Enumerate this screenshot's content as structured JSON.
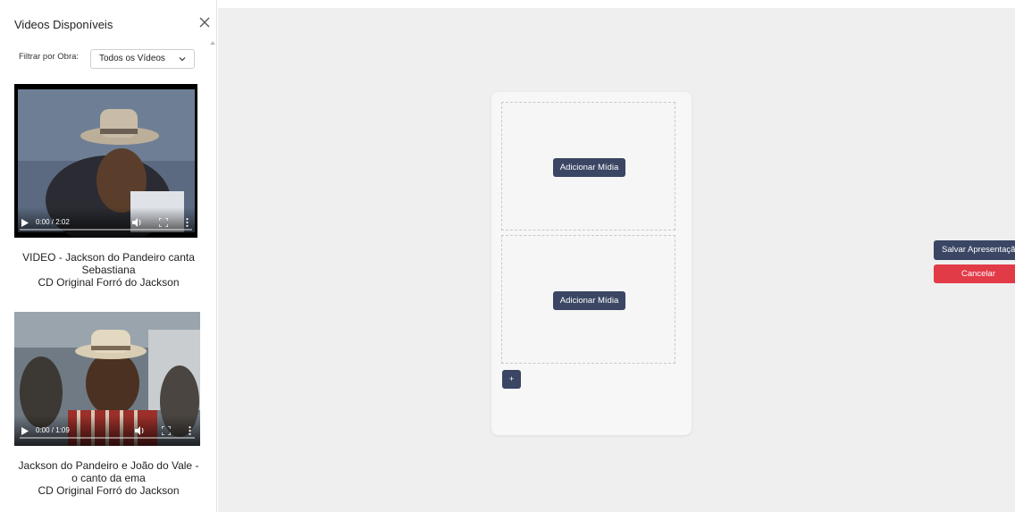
{
  "sidebar": {
    "title": "Videos Disponíveis",
    "filter": {
      "label": "Filtrar por Obra:",
      "selected": "Todos os Vídeos"
    },
    "videos": [
      {
        "time": "0:00 / 2:02",
        "caption_lines": [
          "VIDEO - Jackson do Pandeiro canta",
          "Sebastiana",
          "CD Original Forró do Jackson"
        ]
      },
      {
        "time": "0:00 / 1:09",
        "caption_lines": [
          "Jackson do Pandeiro e João do Vale -",
          "o canto da ema",
          "CD Original Forró do Jackson"
        ]
      }
    ]
  },
  "editor": {
    "slots": [
      {
        "button_label": "Adicionar Mídia"
      },
      {
        "button_label": "Adicionar Mídia"
      }
    ],
    "add_slot_label": "+"
  },
  "actions": {
    "save_label": "Salvar Apresentação",
    "cancel_label": "Cancelar"
  },
  "colors": {
    "primary": "#3a4663",
    "danger": "#e23b48",
    "background": "#efefef"
  }
}
